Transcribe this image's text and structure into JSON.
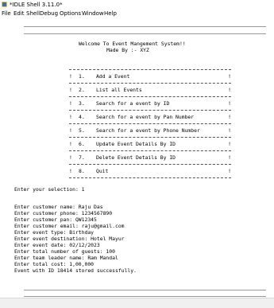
{
  "window": {
    "title": "*IDLE Shell 3.11.0*"
  },
  "menubar": [
    "File",
    "Edit",
    "Shell",
    "Debug",
    "Options",
    "Window",
    "Help"
  ],
  "header": {
    "welcome": "Welcome To Event Mangement System!!",
    "made_by": "Made By :- XYZ"
  },
  "menu_options": [
    {
      "num": "1.",
      "label": "Add a Event"
    },
    {
      "num": "2.",
      "label": "List all Events"
    },
    {
      "num": "3.",
      "label": "Search for a event by ID"
    },
    {
      "num": "4.",
      "label": "Search for a event by Pan Number"
    },
    {
      "num": "5.",
      "label": "Search for a event by Phone Number"
    },
    {
      "num": "6.",
      "label": "Update Event Details By ID"
    },
    {
      "num": "7.",
      "label": "Delete Event Details By ID"
    },
    {
      "num": "8.",
      "label": "Quit"
    }
  ],
  "selection_prompt": "Enter your selection: 1",
  "output_lines": [
    "Enter customer name: Raju Das",
    "Enter customer phone: 1234567890",
    "Enter customer pan: QW12345",
    "Enter customer email: raju@gmail.com",
    "Enter event type: Birthday",
    "Enter event destination: Hotel Mayur",
    "Enter event date: 02/12/2023",
    "Enter total number of guests: 100",
    "Enter team leader name: Ram Mandal",
    "Enter total cost: 1,00,000",
    "Event with ID 18414 stored successfully."
  ]
}
